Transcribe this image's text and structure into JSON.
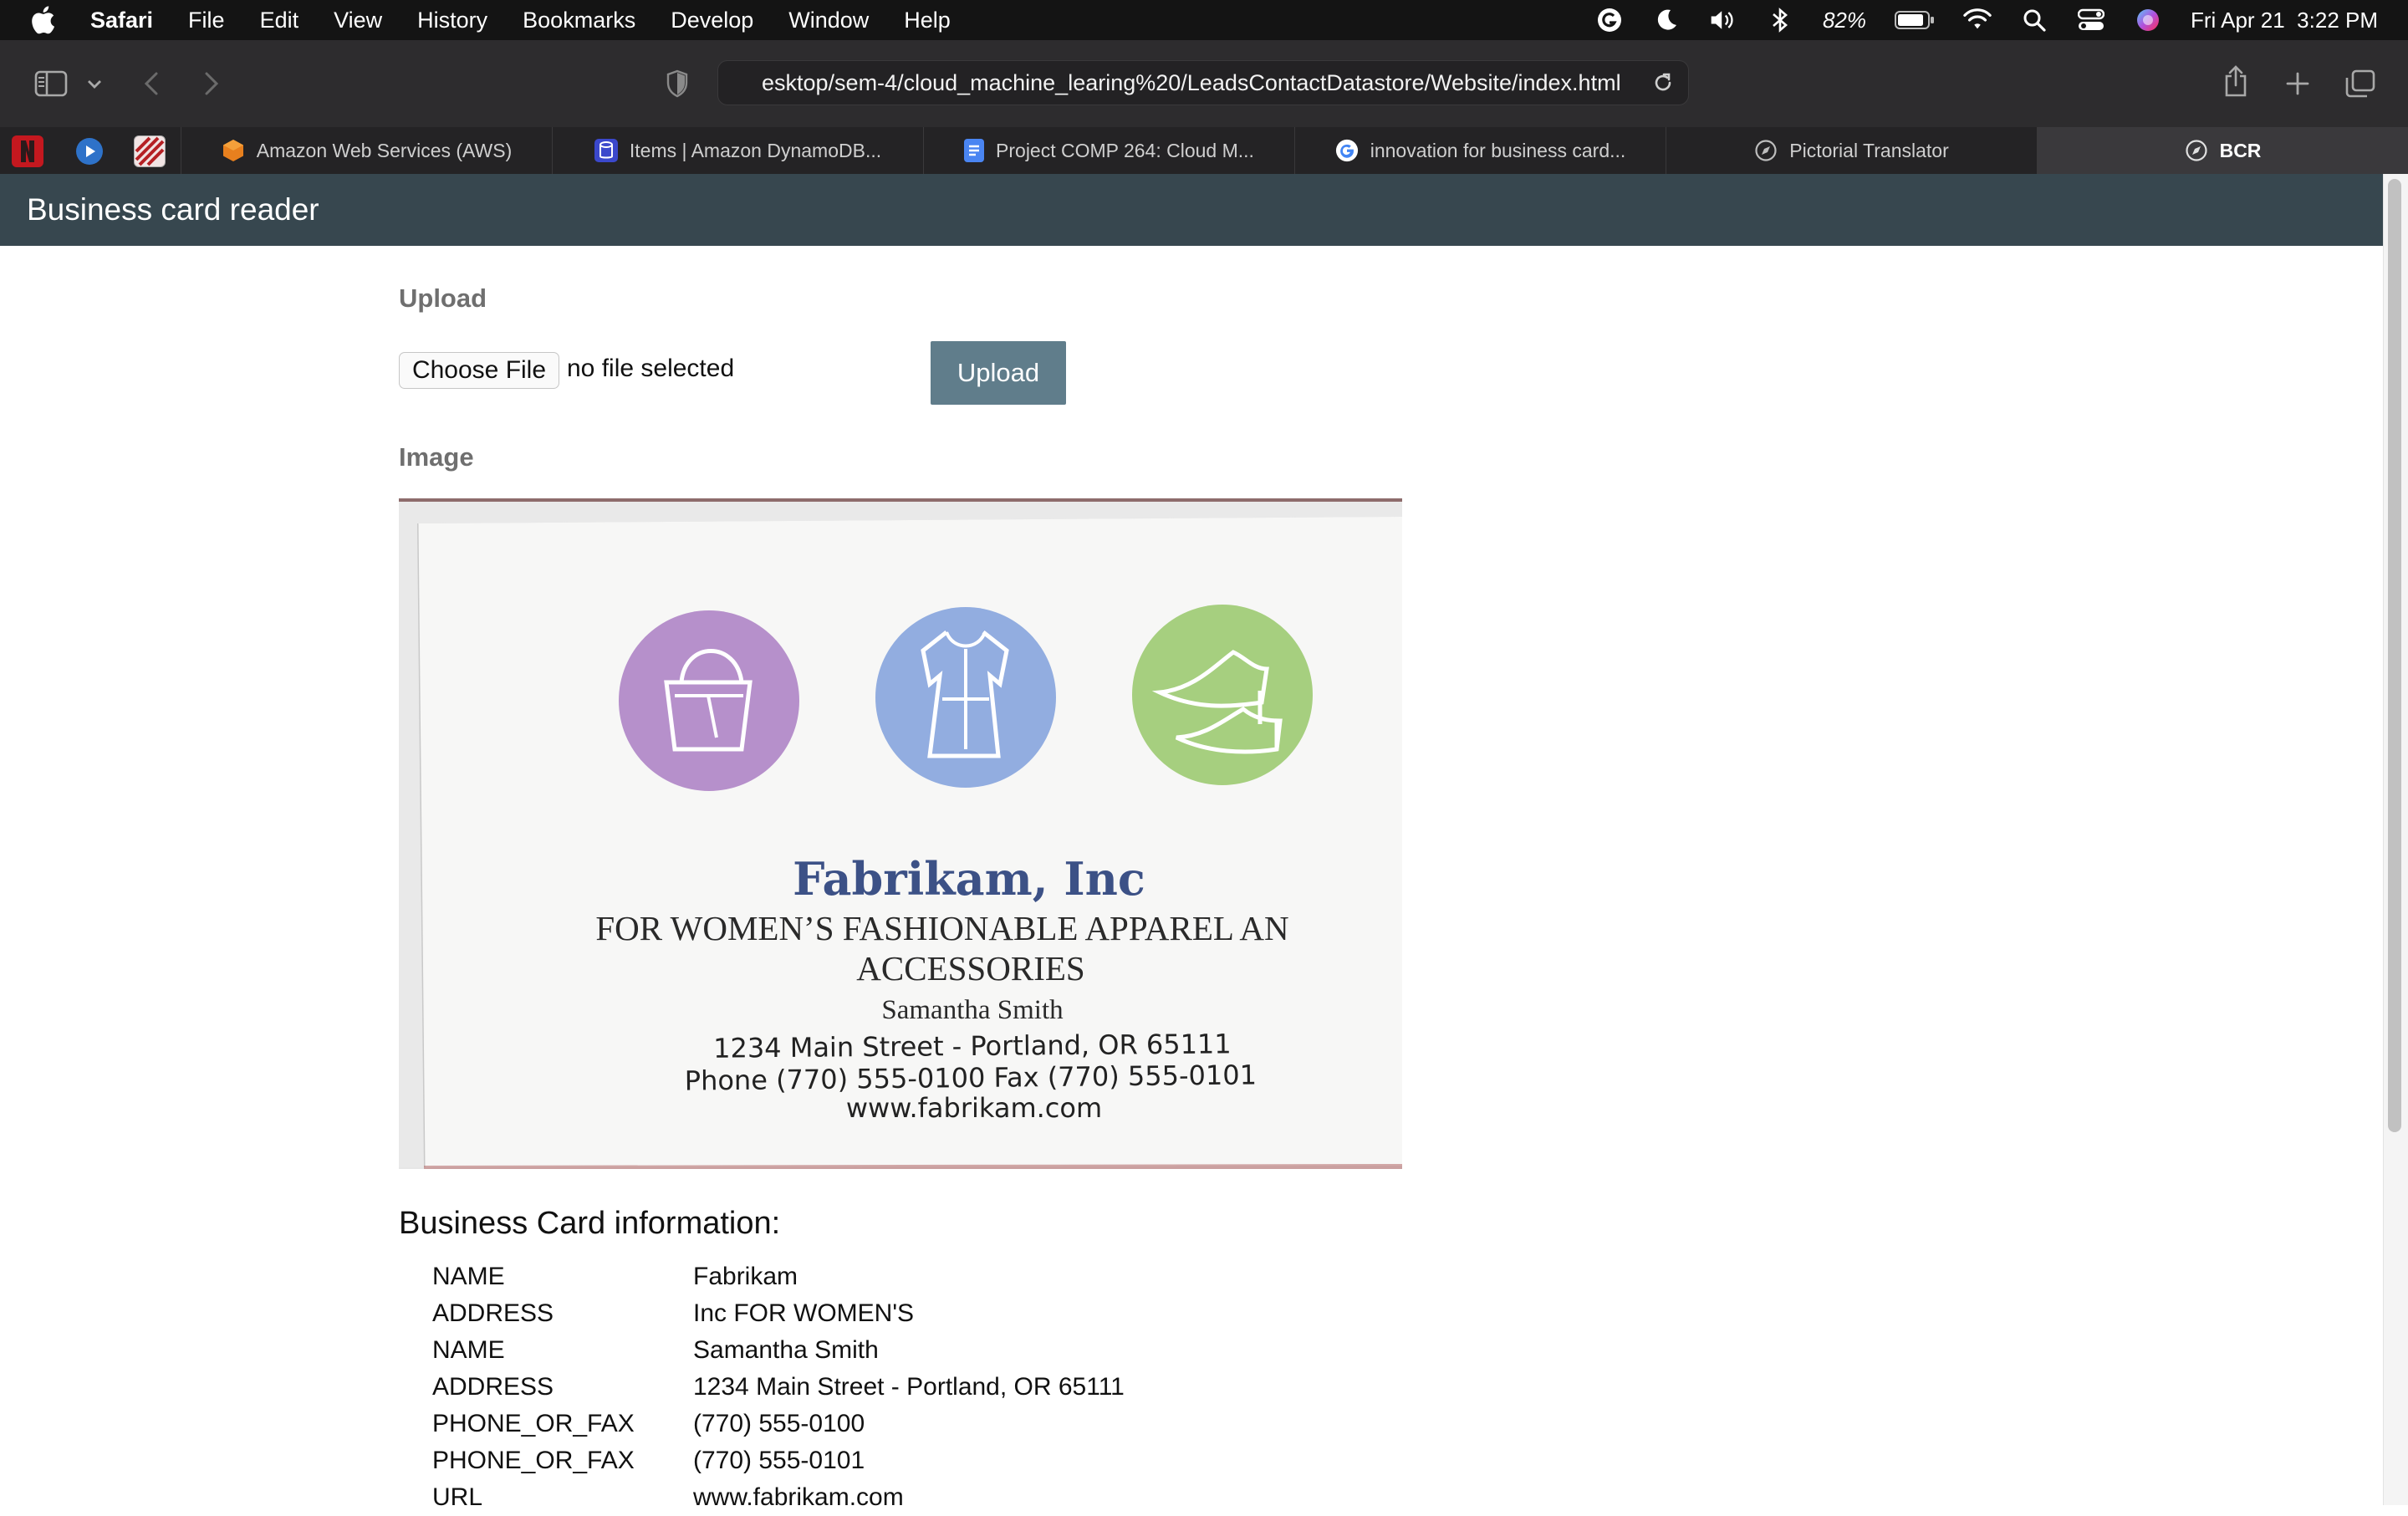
{
  "menubar": {
    "app": "Safari",
    "items": [
      "File",
      "Edit",
      "View",
      "History",
      "Bookmarks",
      "Develop",
      "Window",
      "Help"
    ],
    "battery": "82%",
    "datetime": "Fri Apr 21  3:22 PM"
  },
  "toolbar": {
    "url": "esktop/sem-4/cloud_machine_learing%20/LeadsContactDatastore/Website/index.html"
  },
  "tabs": [
    {
      "label": "Amazon Web Services (AWS)",
      "icon": "aws-icon"
    },
    {
      "label": "Items | Amazon DynamoDB...",
      "icon": "dynamodb-icon"
    },
    {
      "label": "Project COMP 264: Cloud M...",
      "icon": "docs-icon"
    },
    {
      "label": "innovation for business card...",
      "icon": "google-icon"
    },
    {
      "label": "Pictorial Translator",
      "icon": "compass-icon"
    },
    {
      "label": "BCR",
      "icon": "compass-icon"
    }
  ],
  "page": {
    "header": "Business card reader",
    "upload_heading": "Upload",
    "choose_file": "Choose File",
    "no_file": "no file selected",
    "upload_button": "Upload",
    "image_heading": "Image",
    "info_title": "Business Card information:",
    "card": {
      "company": "Fabrikam, Inc",
      "tagline1": "FOR WOMEN’S FASHIONABLE APPAREL AN",
      "tagline2": "ACCESSORIES",
      "person": "Samantha Smith",
      "address": "1234 Main Street - Portland, OR  65111",
      "phone": "Phone (770) 555-0100 Fax (770) 555-0101",
      "web": "www.fabrikam.com"
    },
    "info_rows": [
      {
        "key": "NAME",
        "value": "Fabrikam"
      },
      {
        "key": "ADDRESS",
        "value": "Inc FOR WOMEN'S"
      },
      {
        "key": "NAME",
        "value": "Samantha Smith"
      },
      {
        "key": "ADDRESS",
        "value": "1234 Main Street - Portland, OR 65111"
      },
      {
        "key": "PHONE_OR_FAX",
        "value": "(770) 555-0100"
      },
      {
        "key": "PHONE_OR_FAX",
        "value": "(770) 555-0101"
      },
      {
        "key": "URL",
        "value": "www.fabrikam.com"
      }
    ]
  }
}
